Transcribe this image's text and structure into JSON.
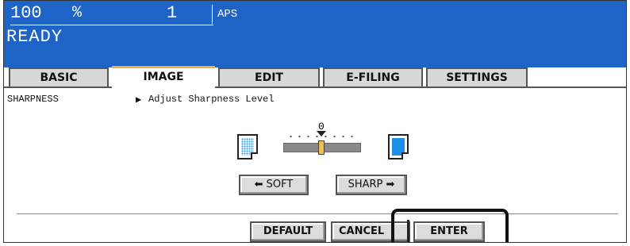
{
  "header": {
    "zoom": "100",
    "zoom_unit": "%",
    "copies": "1",
    "paper": "APS",
    "status": "READY"
  },
  "tabs": [
    {
      "label": "BASIC",
      "active": false
    },
    {
      "label": "IMAGE",
      "active": true
    },
    {
      "label": "EDIT",
      "active": false
    },
    {
      "label": "E-FILING",
      "active": false
    },
    {
      "label": "SETTINGS",
      "active": false
    }
  ],
  "breadcrumb": {
    "section": "SHARPNESS",
    "instruction": "Adjust Sharpness Level"
  },
  "sharpness": {
    "value_label": "0",
    "level": 0,
    "soft_label": "SOFT",
    "sharp_label": "SHARP"
  },
  "footer": {
    "default_label": "DEFAULT",
    "cancel_label": "CANCEL",
    "enter_label": "ENTER"
  },
  "colors": {
    "header_bg": "#1e63c6",
    "active_tab_accent": "#f0b030",
    "slider_thumb": "#f0c050",
    "doc_fill": "#1e8fe6"
  }
}
